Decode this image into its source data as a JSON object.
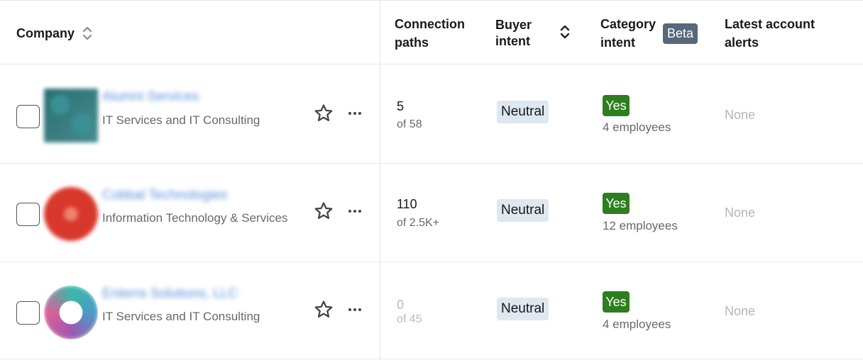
{
  "header": {
    "company": "Company",
    "connection_paths": "Connection paths",
    "buyer_intent": "Buyer intent",
    "category_intent": "Category intent",
    "beta": "Beta",
    "latest_alerts": "Latest account alerts"
  },
  "rows": [
    {
      "name": "Alumni Services",
      "industry": "IT Services and IT Consulting",
      "paths_count": "5",
      "paths_total": "of 58",
      "buyer_intent": "Neutral",
      "category_intent": "Yes",
      "employees": "4 employees",
      "alerts": "None"
    },
    {
      "name": "Cobbal Technologies",
      "industry": "Information Technology & Services",
      "paths_count": "110",
      "paths_total": "of 2.5K+",
      "buyer_intent": "Neutral",
      "category_intent": "Yes",
      "employees": "12 employees",
      "alerts": "None"
    },
    {
      "name": "Enterra Solutions, LLC",
      "industry": "IT Services and IT Consulting",
      "paths_count": "0",
      "paths_total": "of 45",
      "buyer_intent": "Neutral",
      "category_intent": "Yes",
      "employees": "4 employees",
      "alerts": "None"
    }
  ],
  "icons": {
    "sort": "sort-icon",
    "star": "star-icon",
    "more": "more-icon"
  },
  "colors": {
    "beta_badge": "#56687a",
    "yes_badge": "#2e7d1f",
    "neutral_badge": "#dfe7f0"
  }
}
